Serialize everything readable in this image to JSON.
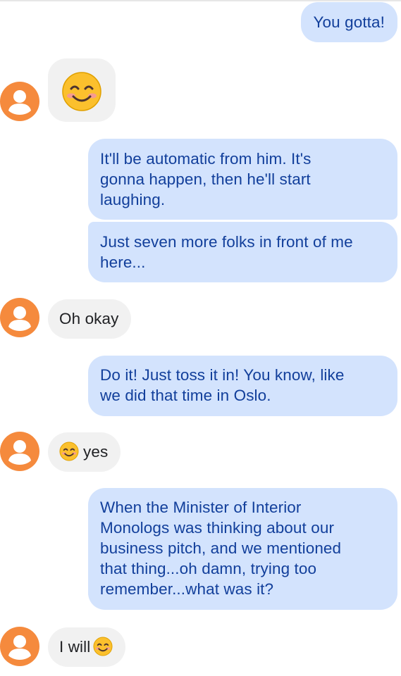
{
  "conversation": {
    "messages": [
      {
        "direction": "outgoing",
        "lines": [
          "You gotta!"
        ]
      },
      {
        "direction": "incoming",
        "emoji": "smiling-face-with-smiling-eyes"
      },
      {
        "direction": "outgoing",
        "lines": [
          "It'll be automatic from him.  It's",
          "gonna happen, then he'll start",
          "laughing."
        ]
      },
      {
        "direction": "outgoing",
        "lines": [
          "Just seven more folks in front of me",
          "here..."
        ]
      },
      {
        "direction": "incoming",
        "text": "Oh okay"
      },
      {
        "direction": "outgoing",
        "lines": [
          "Do it!  Just toss it in!  You know, like",
          "we did that time in Oslo."
        ]
      },
      {
        "direction": "incoming",
        "text": "yes",
        "leading_emoji": "smiling-face-with-smiling-eyes"
      },
      {
        "direction": "outgoing",
        "lines": [
          "When the Minister of Interior",
          "Monologs was thinking about our",
          "business pitch, and we mentioned",
          "that thing...oh damn, trying too",
          "remember...what was it?"
        ]
      },
      {
        "direction": "incoming",
        "text": "I will",
        "trailing_emoji": "smiling-face-with-smiling-eyes"
      }
    ]
  },
  "colors": {
    "outgoing_bubble": "#d3e3fd",
    "outgoing_text": "#123f9b",
    "incoming_bubble": "#f1f1f1",
    "incoming_text": "#202124",
    "avatar": "#f58a3d"
  },
  "icons": {
    "avatar": "person-icon",
    "emoji": "smiling-face-with-smiling-eyes"
  }
}
